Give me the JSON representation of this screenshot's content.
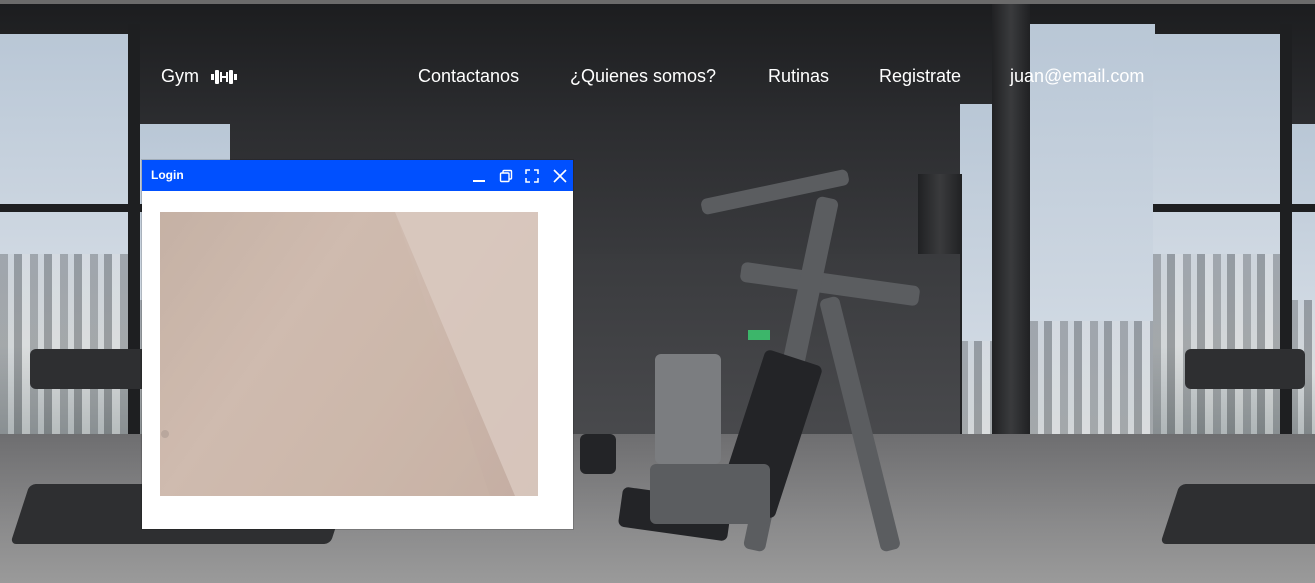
{
  "nav": {
    "brand": "Gym",
    "brand_icon": "dumbbell-icon",
    "links": [
      "Contactanos",
      "¿Quienes somos?",
      "Rutinas",
      "Registrate"
    ],
    "user_email": "juan@email.com"
  },
  "login_window": {
    "title": "Login",
    "controls": [
      "minimize-icon",
      "restore-icon",
      "fullscreen-icon",
      "close-icon"
    ],
    "content": "camera-feed"
  },
  "colors": {
    "titlebar": "#0050ff",
    "nav_text": "#ffffff",
    "window_bg": "#ffffff"
  }
}
